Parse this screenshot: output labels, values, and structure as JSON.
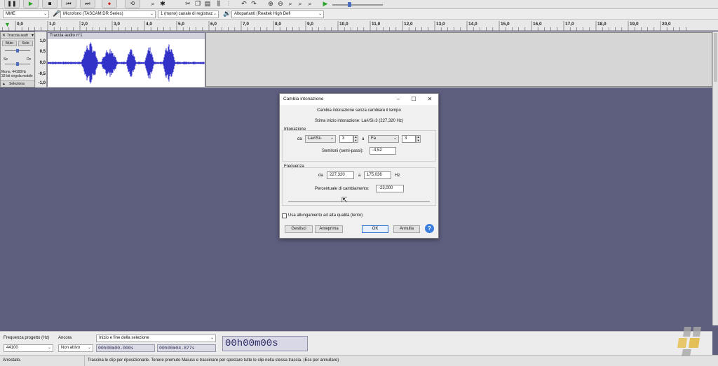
{
  "device_toolbar": {
    "host": "MME",
    "mic_device": "Microfono (TASCAM DR Series)",
    "channels": "1 (mono) canale di registraz",
    "speaker_device": "Altoparlanti (Realtek High Defi"
  },
  "ruler": {
    "ticks": [
      "1,0",
      "0,0",
      "1,0",
      "2,0",
      "3,0",
      "4,0",
      "5,0",
      "6,0",
      "7,0",
      "8,0",
      "9,0",
      "10,0",
      "11,0",
      "12,0",
      "13,0",
      "14,0",
      "15,0",
      "16,0",
      "17,0",
      "18,0",
      "19,0",
      "20,0"
    ]
  },
  "track": {
    "name": "Traccia audi",
    "mute": "Muto",
    "solo": "Solo",
    "left": "Sx",
    "right": "Dx",
    "info1": "Mono, 44100Hz",
    "info2": "32-bit virgola mobile",
    "select": "Seleziona",
    "clip_title": "Traccia audio n°1",
    "scale": [
      "1,0",
      "0,5",
      "0,0",
      "-0,5",
      "-1,0"
    ]
  },
  "dialog": {
    "title": "Cambia intonazione",
    "subtitle": "Cambia intonazione senza cambiare il tempo",
    "estimate": "Stima inizio intonazione: La#/Si♭3 (227,320 Hz)",
    "pitch_group": "Intonazione",
    "from_label": "da",
    "from_note": "La#/Si♭",
    "from_octave": "3",
    "to_label": "a",
    "to_note": "Fa",
    "to_octave": "3",
    "semitones_label": "Semitoni (semi-passi):",
    "semitones_value": "-4,52",
    "freq_group": "Frequenza",
    "freq_from_label": "da",
    "freq_from": "227,320",
    "freq_to_label": "a",
    "freq_to": "175,036",
    "hz": "Hz",
    "percent_label": "Percentuale di cambiamento:",
    "percent_value": "-23,000",
    "high_quality": "Usa allungamento ad alta qualità (lento)",
    "manage": "Gestisci",
    "preview": "Anteprima",
    "ok": "OK",
    "cancel": "Annulla"
  },
  "selection_bar": {
    "rate_label": "Frequenza progetto (Hz)",
    "rate_value": "44100",
    "snap_label": "Ancora",
    "snap_value": "Non attivo",
    "range_label": "Inizio e fine della selezione",
    "start": "00h00m00.000s",
    "end": "00h00m04.877s",
    "position": "00h00m00s"
  },
  "status": {
    "state": "Arrestato.",
    "hint": "Trascina le clip per riposizionarle. Tenere premuto Maiusc e trascinare per spostare tutte le clip nella stessa traccia. (Esc per annullare)"
  },
  "colors": {
    "background": "#5e5e7f",
    "waveform": "#3232c8",
    "accent": "#3b7ede",
    "play": "#2aa52a",
    "record": "#d02020"
  },
  "icons": [
    "pause-icon",
    "play-icon",
    "stop-icon",
    "skip-end-icon",
    "record-icon",
    "loop-icon",
    "zoom-icon",
    "multi-tool-icon",
    "cut-icon",
    "copy-icon",
    "paste-icon",
    "trim-icon",
    "silence-icon",
    "undo-icon",
    "redo-icon",
    "zoom-in-icon",
    "zoom-out-icon",
    "fit-selection-icon",
    "fit-project-icon",
    "play-at-speed-icon",
    "microphone-icon",
    "speaker-icon",
    "close-icon",
    "maximize-icon",
    "minimize-icon",
    "help-icon"
  ]
}
